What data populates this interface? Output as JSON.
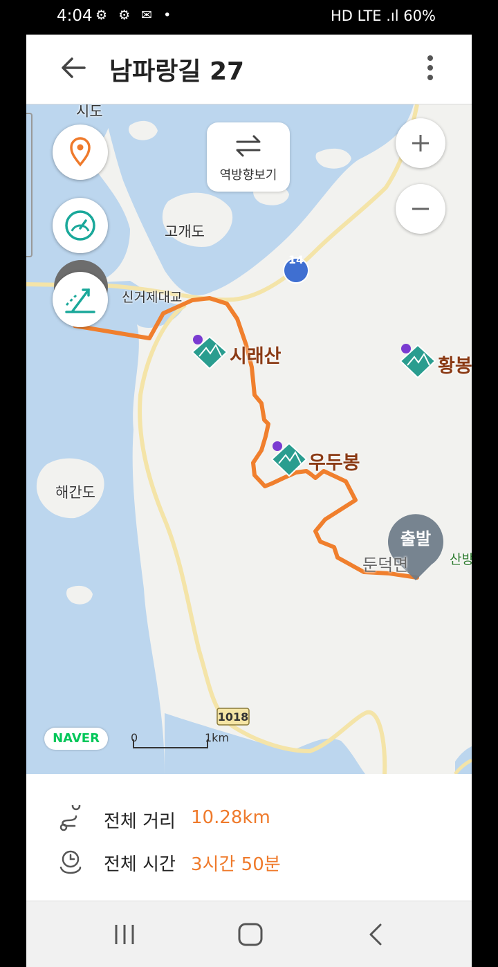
{
  "status_bar": {
    "time": "4:04",
    "notifications": "⚙ ⚙ ✉ •",
    "system_info": "HD LTE .ıl 60%"
  },
  "app_bar": {
    "title": "남파랑길 27"
  },
  "map": {
    "reverse_label": "역방향보기",
    "place_labels": {
      "sido": "시도",
      "gogaedo": "고개도",
      "singeoje": "신거제대교",
      "haegando": "해간도",
      "dundeok": "둔덕면",
      "sanbang": "산방"
    },
    "peaks": {
      "siraesan": "시래산",
      "udubong": "우두봉",
      "hwangbong": "황봉"
    },
    "road_shields": {
      "route14": "14",
      "route1018": "1018"
    },
    "start_marker": "출발",
    "brand": "NAVER",
    "scale_zero": "0",
    "scale_km": "1km",
    "colors": {
      "water": "#bcd6ee",
      "land": "#f2f2ef",
      "route": "#f07f2d",
      "peak_icon": "#2a9d8f",
      "road": "#f4e4a8"
    }
  },
  "summary": {
    "distance_label": "전체 거리",
    "distance_value": "10.28km",
    "time_label": "전체 시간",
    "time_value": "3시간 50분"
  }
}
